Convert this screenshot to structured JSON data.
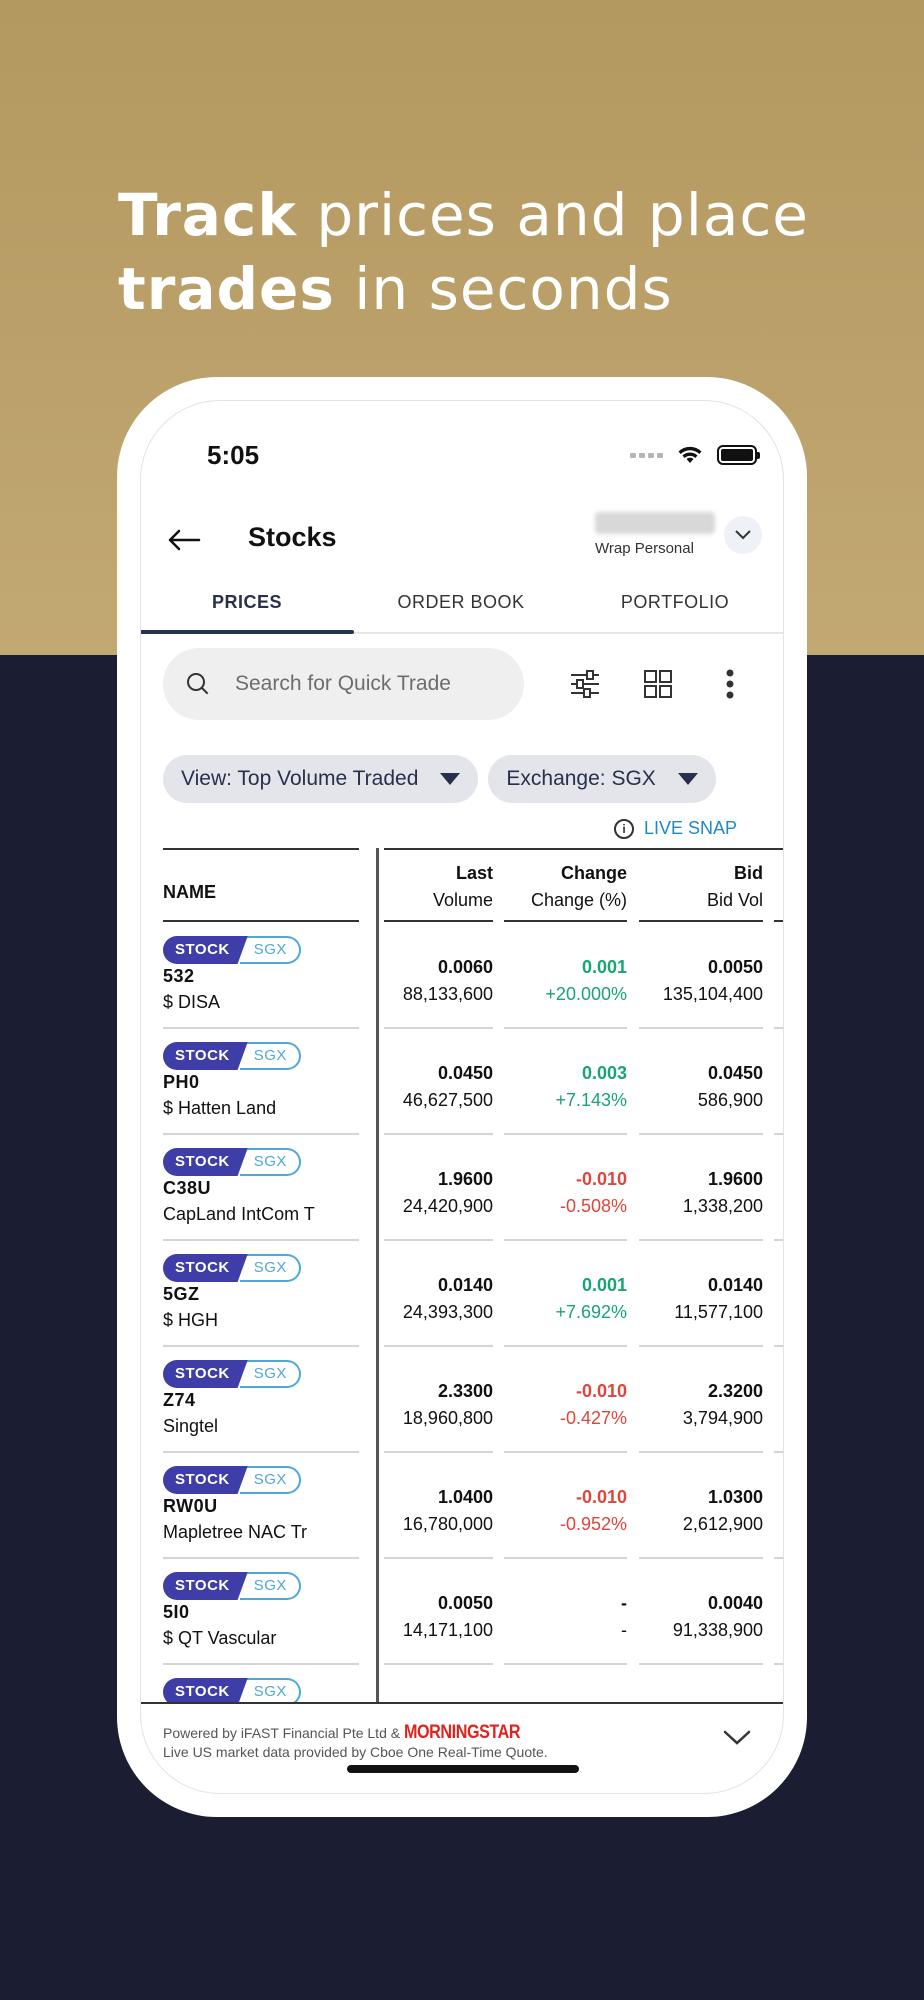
{
  "headline": {
    "bold1": "Track",
    "rest1": " prices and place",
    "bold2": "trades",
    "rest2": " in seconds"
  },
  "status_bar": {
    "time": "5:05"
  },
  "header": {
    "title": "Stocks",
    "account_type": "Wrap Personal"
  },
  "tabs": [
    {
      "label": "PRICES",
      "active": true
    },
    {
      "label": "ORDER BOOK",
      "active": false
    },
    {
      "label": "PORTFOLIO",
      "active": false
    }
  ],
  "search": {
    "placeholder": "Search for Quick Trade"
  },
  "filters": {
    "view": "View: Top Volume Traded",
    "exchange": "Exchange: SGX"
  },
  "live_snap": "LIVE SNAP",
  "table": {
    "headers": {
      "name": "NAME",
      "last": "Last",
      "volume": "Volume",
      "change": "Change",
      "change_pct": "Change (%)",
      "bid": "Bid",
      "bid_vol": "Bid Vol"
    },
    "rows": [
      {
        "type": "STOCK",
        "exchange": "SGX",
        "symbol": "532",
        "name": "$ DISA",
        "last": "0.0060",
        "volume": "88,133,600",
        "change": "0.001",
        "change_pct": "+20.000%",
        "trend": "up",
        "bid": "0.0050",
        "bid_vol": "135,104,400"
      },
      {
        "type": "STOCK",
        "exchange": "SGX",
        "symbol": "PH0",
        "name": "$ Hatten Land",
        "last": "0.0450",
        "volume": "46,627,500",
        "change": "0.003",
        "change_pct": "+7.143%",
        "trend": "up",
        "bid": "0.0450",
        "bid_vol": "586,900"
      },
      {
        "type": "STOCK",
        "exchange": "SGX",
        "symbol": "C38U",
        "name": "CapLand IntCom T",
        "last": "1.9600",
        "volume": "24,420,900",
        "change": "-0.010",
        "change_pct": "-0.508%",
        "trend": "down",
        "bid": "1.9600",
        "bid_vol": "1,338,200"
      },
      {
        "type": "STOCK",
        "exchange": "SGX",
        "symbol": "5GZ",
        "name": "$ HGH",
        "last": "0.0140",
        "volume": "24,393,300",
        "change": "0.001",
        "change_pct": "+7.692%",
        "trend": "up",
        "bid": "0.0140",
        "bid_vol": "11,577,100"
      },
      {
        "type": "STOCK",
        "exchange": "SGX",
        "symbol": "Z74",
        "name": "Singtel",
        "last": "2.3300",
        "volume": "18,960,800",
        "change": "-0.010",
        "change_pct": "-0.427%",
        "trend": "down",
        "bid": "2.3200",
        "bid_vol": "3,794,900"
      },
      {
        "type": "STOCK",
        "exchange": "SGX",
        "symbol": "RW0U",
        "name": "Mapletree NAC Tr",
        "last": "1.0400",
        "volume": "16,780,000",
        "change": "-0.010",
        "change_pct": "-0.952%",
        "trend": "down",
        "bid": "1.0300",
        "bid_vol": "2,612,900"
      },
      {
        "type": "STOCK",
        "exchange": "SGX",
        "symbol": "5I0",
        "name": "$ QT Vascular",
        "last": "0.0050",
        "volume": "14,171,100",
        "change": "-",
        "change_pct": "-",
        "trend": "neutral",
        "bid": "0.0040",
        "bid_vol": "91,338,900"
      },
      {
        "type": "STOCK",
        "exchange": "SGX",
        "symbol": "",
        "name": "",
        "last": "",
        "volume": "",
        "change": "",
        "change_pct": "",
        "trend": "neutral",
        "bid": "",
        "bid_vol": ""
      }
    ]
  },
  "footer": {
    "powered_by": "Powered by iFAST Financial Pte Ltd &",
    "logo_text": "MORNINGSTAR",
    "live_us": "Live US market data provided by Cboe One Real-Time Quote."
  },
  "colors": {
    "gold": "#b39860",
    "navy": "#1b1e33",
    "up": "#18a571",
    "down": "#e0453c",
    "badge": "#3f3ea8",
    "link": "#1e88c8"
  }
}
